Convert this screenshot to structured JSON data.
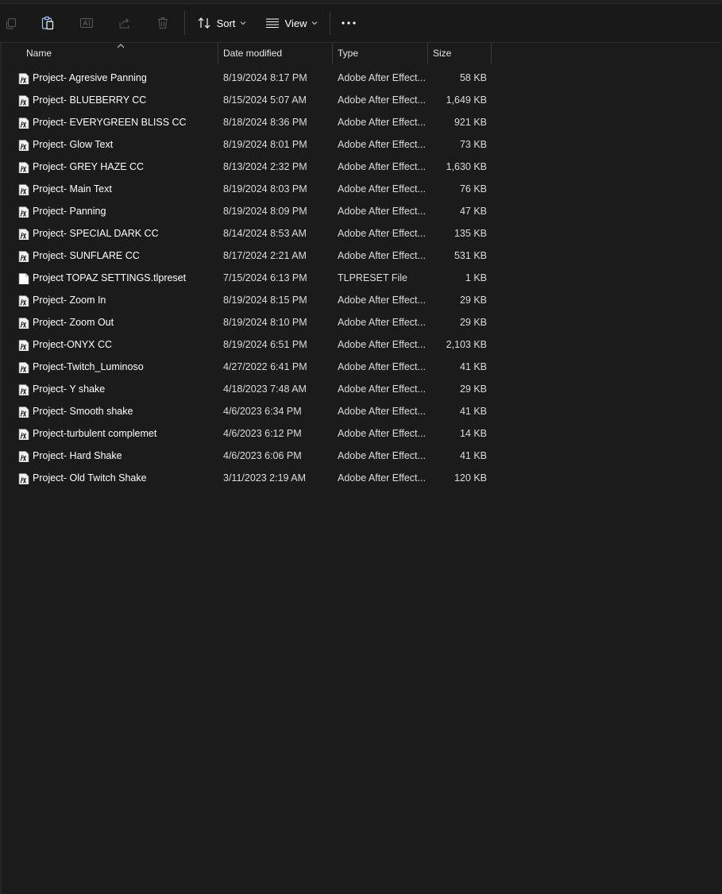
{
  "toolbar": {
    "sort_label": "Sort",
    "view_label": "View",
    "icons": [
      "copy-icon",
      "paste-icon",
      "rename-icon",
      "share-icon",
      "delete-icon",
      "sort-icon",
      "view-icon",
      "more-icon"
    ]
  },
  "columns": {
    "name": "Name",
    "date": "Date modified",
    "type": "Type",
    "size": "Size"
  },
  "files": [
    {
      "name": "Project- Agresive Panning",
      "date": "8/19/2024 8:17 PM",
      "type": "Adobe After Effect...",
      "size": "58 KB",
      "icon": "after-effects-preset-icon"
    },
    {
      "name": "Project- BLUEBERRY CC",
      "date": "8/15/2024 5:07 AM",
      "type": "Adobe After Effect...",
      "size": "1,649 KB",
      "icon": "after-effects-preset-icon"
    },
    {
      "name": "Project- EVERYGREEN BLISS CC",
      "date": "8/18/2024 8:36 PM",
      "type": "Adobe After Effect...",
      "size": "921 KB",
      "icon": "after-effects-preset-icon"
    },
    {
      "name": "Project- Glow Text",
      "date": "8/19/2024 8:01 PM",
      "type": "Adobe After Effect...",
      "size": "73 KB",
      "icon": "after-effects-preset-icon"
    },
    {
      "name": "Project- GREY HAZE CC",
      "date": "8/13/2024 2:32 PM",
      "type": "Adobe After Effect...",
      "size": "1,630 KB",
      "icon": "after-effects-preset-icon"
    },
    {
      "name": "Project- Main Text",
      "date": "8/19/2024 8:03 PM",
      "type": "Adobe After Effect...",
      "size": "76 KB",
      "icon": "after-effects-preset-icon"
    },
    {
      "name": "Project- Panning",
      "date": "8/19/2024 8:09 PM",
      "type": "Adobe After Effect...",
      "size": "47 KB",
      "icon": "after-effects-preset-icon"
    },
    {
      "name": "Project- SPECIAL DARK CC",
      "date": "8/14/2024 8:53 AM",
      "type": "Adobe After Effect...",
      "size": "135 KB",
      "icon": "after-effects-preset-icon"
    },
    {
      "name": "Project- SUNFLARE CC",
      "date": "8/17/2024 2:21 AM",
      "type": "Adobe After Effect...",
      "size": "531 KB",
      "icon": "after-effects-preset-icon"
    },
    {
      "name": "Project TOPAZ SETTINGS.tlpreset",
      "date": "7/15/2024 6:13 PM",
      "type": "TLPRESET File",
      "size": "1 KB",
      "icon": "blank-file-icon"
    },
    {
      "name": "Project- Zoom In",
      "date": "8/19/2024 8:15 PM",
      "type": "Adobe After Effect...",
      "size": "29 KB",
      "icon": "after-effects-preset-icon"
    },
    {
      "name": "Project- Zoom Out",
      "date": "8/19/2024 8:10 PM",
      "type": "Adobe After Effect...",
      "size": "29 KB",
      "icon": "after-effects-preset-icon"
    },
    {
      "name": "Project-ONYX CC",
      "date": "8/19/2024 6:51 PM",
      "type": "Adobe After Effect...",
      "size": "2,103 KB",
      "icon": "after-effects-preset-icon"
    },
    {
      "name": "Project-Twitch_Luminoso",
      "date": "4/27/2022 6:41 PM",
      "type": "Adobe After Effect...",
      "size": "41 KB",
      "icon": "after-effects-preset-icon"
    },
    {
      "name": "Project- Y shake",
      "date": "4/18/2023 7:48 AM",
      "type": "Adobe After Effect...",
      "size": "29 KB",
      "icon": "after-effects-preset-icon"
    },
    {
      "name": "Project- Smooth shake",
      "date": "4/6/2023 6:34 PM",
      "type": "Adobe After Effect...",
      "size": "41 KB",
      "icon": "after-effects-preset-icon"
    },
    {
      "name": "Project-turbulent complemet",
      "date": "4/6/2023 6:12 PM",
      "type": "Adobe After Effect...",
      "size": "14 KB",
      "icon": "after-effects-preset-icon"
    },
    {
      "name": "Project- Hard Shake",
      "date": "4/6/2023 6:06 PM",
      "type": "Adobe After Effect...",
      "size": "41 KB",
      "icon": "after-effects-preset-icon"
    },
    {
      "name": "Project- Old Twitch Shake",
      "date": "3/11/2023 2:19 AM",
      "type": "Adobe After Effect...",
      "size": "120 KB",
      "icon": "after-effects-preset-icon"
    }
  ],
  "colors": {
    "background": "#1b1b1b",
    "toolbar": "#191919",
    "text": "#ffffff",
    "divider": "#3a3a3a"
  }
}
